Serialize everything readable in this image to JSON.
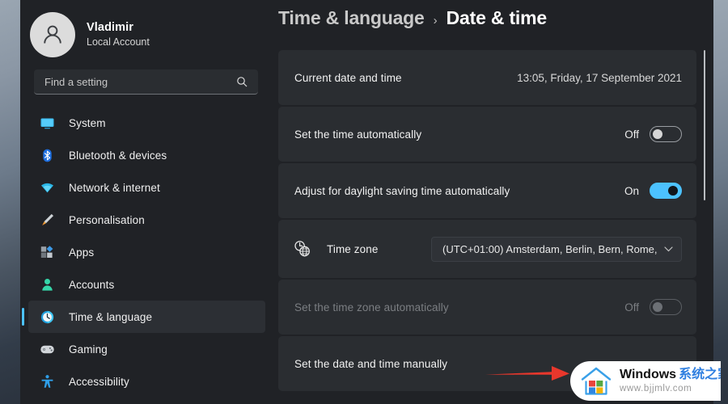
{
  "account": {
    "name": "Vladimir",
    "type": "Local Account",
    "avatar_icon": "person-avatar-icon"
  },
  "search": {
    "placeholder": "Find a setting",
    "value": "",
    "icon": "search-icon"
  },
  "sidebar": {
    "items": [
      {
        "label": "System",
        "icon": "monitor-icon",
        "selected": false
      },
      {
        "label": "Bluetooth & devices",
        "icon": "bluetooth-icon",
        "selected": false
      },
      {
        "label": "Network & internet",
        "icon": "wifi-icon",
        "selected": false
      },
      {
        "label": "Personalisation",
        "icon": "paintbrush-icon",
        "selected": false
      },
      {
        "label": "Apps",
        "icon": "apps-grid-icon",
        "selected": false
      },
      {
        "label": "Accounts",
        "icon": "person-icon",
        "selected": false
      },
      {
        "label": "Time & language",
        "icon": "clock-icon",
        "selected": true
      },
      {
        "label": "Gaming",
        "icon": "gamepad-icon",
        "selected": false
      },
      {
        "label": "Accessibility",
        "icon": "accessibility-icon",
        "selected": false
      }
    ]
  },
  "header": {
    "breadcrumb_parent": "Time & language",
    "breadcrumb_separator": "›",
    "breadcrumb_current": "Date & time"
  },
  "settings": {
    "current_date_time": {
      "label": "Current date and time",
      "value": "13:05, Friday, 17 September 2021"
    },
    "set_time_automatically": {
      "label": "Set the time automatically",
      "state": "Off"
    },
    "adjust_dst": {
      "label": "Adjust for daylight saving time automatically",
      "state": "On"
    },
    "time_zone": {
      "label": "Time zone",
      "icon": "clock-globe-icon",
      "value": "(UTC+01:00) Amsterdam, Berlin, Bern, Rome,",
      "chevron": "chevron-down-icon"
    },
    "set_time_zone_automatically": {
      "label": "Set the time zone automatically",
      "state": "Off"
    },
    "set_date_time_manually": {
      "label": "Set the date and time manually"
    }
  },
  "annotation": {
    "arrow_color": "#e8372c",
    "arrow_name": "red-pointer-arrow"
  },
  "watermark": {
    "brand": "Windows",
    "brand_cn": "系统之家",
    "url": "www.bjjmlv.com"
  },
  "colors": {
    "accent": "#4cc2ff",
    "window_bg": "#202226",
    "card_bg": "#2a2d31",
    "text_primary": "#f2f2f2",
    "text_dim": "#7b7e82"
  }
}
